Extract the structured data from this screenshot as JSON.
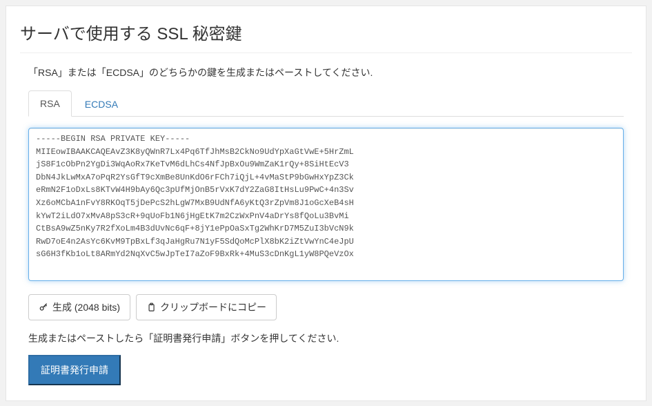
{
  "title": "サーバで使用する SSL 秘密鍵",
  "instruction": "「RSA」または「ECDSA」のどちらかの鍵を生成またはペーストしてください.",
  "tabs": [
    {
      "label": "RSA",
      "active": true
    },
    {
      "label": "ECDSA",
      "active": false
    }
  ],
  "key_text": "-----BEGIN RSA PRIVATE KEY-----\nMIIEowIBAAKCAQEAvZ3K8yQWnR7Lx4Pq6TfJhMsB2CkNo9UdYpXaGtVwE+5HrZmL\njS8F1cObPn2YgDi3WqAoRx7KeTvM6dLhCs4NfJpBxOu9WmZaK1rQy+8SiHtEcV3\nDbN4JkLwMxA7oPqR2YsGfT9cXmBe8UnKdO6rFCh7iQjL+4vMaStP9bGwHxYpZ3Ck\neRmN2F1oDxLs8KTvW4H9bAy6Qc3pUfMjOnB5rVxK7dY2ZaG8ItHsLu9PwC+4n3Sv\nXz6oMCbA1nFvY8RKOqT5jDePcS2hLgW7MxB9UdNfA6yKtQ3rZpVm8J1oGcXeB4sH\nkYwT2iLdO7xMvA8pS3cR+9qUoFb1N6jHgEtK7m2CzWxPnV4aDrYs8fQoLu3BvMi\nCtBsA9wZ5nKy7R2fXoLm4B3dUvNc6qF+8jY1ePpOaSxTg2WhKrD7M5ZuI3bVcN9k\nRwD7oE4n2AsYc6KvM9TpBxLf3qJaHgRu7N1yF5SdQoMcPlX8bK2iZtVwYnC4eJpU\nsG6H3fKb1oLt8ARmYd2NqXvC5wJpTeI7aZoF9BxRk+4MuS3cDnKgL1yW8PQeVzOx",
  "buttons": {
    "generate": "生成 (2048 bits)",
    "copy": "クリップボードにコピー"
  },
  "note": "生成またはペーストしたら「証明書発行申請」ボタンを押してください.",
  "submit": "証明書発行申請"
}
